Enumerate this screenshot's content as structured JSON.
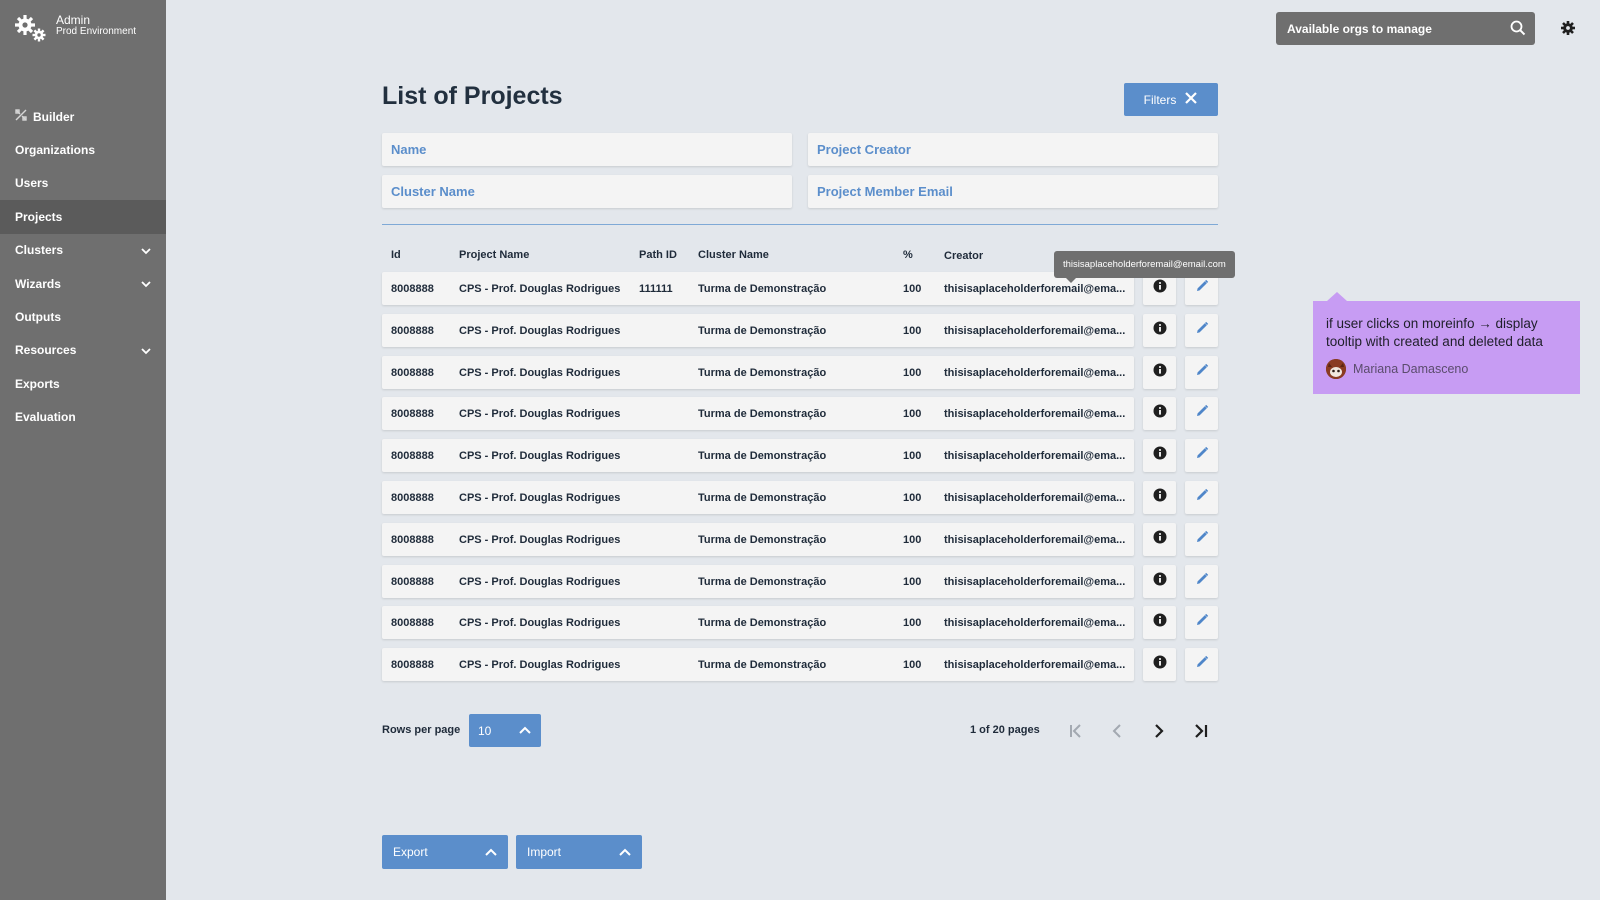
{
  "sidebar": {
    "brand": {
      "title": "Admin",
      "subtitle": "Prod Environment"
    },
    "items": [
      {
        "label": "Builder",
        "icon": "builder-icon",
        "expandable": false,
        "active": false
      },
      {
        "label": "Organizations",
        "expandable": false,
        "active": false
      },
      {
        "label": "Users",
        "expandable": false,
        "active": false
      },
      {
        "label": "Projects",
        "expandable": false,
        "active": true
      },
      {
        "label": "Clusters",
        "expandable": true,
        "active": false
      },
      {
        "label": "Wizards",
        "expandable": true,
        "active": false
      },
      {
        "label": "Outputs",
        "expandable": false,
        "active": false
      },
      {
        "label": "Resources",
        "expandable": true,
        "active": false
      },
      {
        "label": "Exports",
        "expandable": false,
        "active": false
      },
      {
        "label": "Evaluation",
        "expandable": false,
        "active": false
      }
    ]
  },
  "topbar": {
    "search_placeholder": "Available orgs to manage"
  },
  "main": {
    "title": "List of Projects",
    "filters_label": "Filters",
    "filter_fields": {
      "name": "Name",
      "creator": "Project Creator",
      "cluster": "Cluster Name",
      "member_email": "Project Member Email"
    },
    "columns": {
      "id": "Id",
      "project_name": "Project Name",
      "path_id": "Path ID",
      "cluster_name": "Cluster Name",
      "percent": "%",
      "creator": "Creator"
    },
    "rows": [
      {
        "id": "8008888",
        "project_name": "CPS - Prof. Douglas Rodrigues",
        "path_id": "111111",
        "cluster_name": "Turma de Demonstração",
        "percent": "100",
        "creator": "thisisaplaceholderforemail@ema..."
      },
      {
        "id": "8008888",
        "project_name": "CPS - Prof. Douglas Rodrigues",
        "path_id": "",
        "cluster_name": "Turma de Demonstração",
        "percent": "100",
        "creator": "thisisaplaceholderforemail@ema..."
      },
      {
        "id": "8008888",
        "project_name": "CPS - Prof. Douglas Rodrigues",
        "path_id": "",
        "cluster_name": "Turma de Demonstração",
        "percent": "100",
        "creator": "thisisaplaceholderforemail@ema..."
      },
      {
        "id": "8008888",
        "project_name": "CPS - Prof. Douglas Rodrigues",
        "path_id": "",
        "cluster_name": "Turma de Demonstração",
        "percent": "100",
        "creator": "thisisaplaceholderforemail@ema..."
      },
      {
        "id": "8008888",
        "project_name": "CPS - Prof. Douglas Rodrigues",
        "path_id": "",
        "cluster_name": "Turma de Demonstração",
        "percent": "100",
        "creator": "thisisaplaceholderforemail@ema..."
      },
      {
        "id": "8008888",
        "project_name": "CPS - Prof. Douglas Rodrigues",
        "path_id": "",
        "cluster_name": "Turma de Demonstração",
        "percent": "100",
        "creator": "thisisaplaceholderforemail@ema..."
      },
      {
        "id": "8008888",
        "project_name": "CPS - Prof. Douglas Rodrigues",
        "path_id": "",
        "cluster_name": "Turma de Demonstração",
        "percent": "100",
        "creator": "thisisaplaceholderforemail@ema..."
      },
      {
        "id": "8008888",
        "project_name": "CPS - Prof. Douglas Rodrigues",
        "path_id": "",
        "cluster_name": "Turma de Demonstração",
        "percent": "100",
        "creator": "thisisaplaceholderforemail@ema..."
      },
      {
        "id": "8008888",
        "project_name": "CPS - Prof. Douglas Rodrigues",
        "path_id": "",
        "cluster_name": "Turma de Demonstração",
        "percent": "100",
        "creator": "thisisaplaceholderforemail@ema..."
      },
      {
        "id": "8008888",
        "project_name": "CPS - Prof. Douglas Rodrigues",
        "path_id": "",
        "cluster_name": "Turma de Demonstração",
        "percent": "100",
        "creator": "thisisaplaceholderforemail@ema..."
      }
    ],
    "email_tooltip": "thisisaplaceholderforemail@email.com",
    "pagination": {
      "rows_per_page_label": "Rows per page",
      "rows_per_page_value": "10",
      "page_info": "1 of 20 pages"
    },
    "export_label": "Export",
    "import_label": "Import"
  },
  "annotation": {
    "text": "if user clicks on moreinfo → display tooltip with created and deleted data",
    "author": "Mariana Damasceno"
  },
  "colors": {
    "sidebar_bg": "#6f6f6f",
    "accent": "#5b8ecb",
    "page_bg": "#e3e7ec",
    "note_bg": "#c79cf3"
  },
  "icons": [
    "gears-icon",
    "builder-icon",
    "chevron-down-icon",
    "search-icon",
    "gear-icon",
    "close-icon",
    "info-icon",
    "pencil-icon",
    "chevron-up-icon",
    "first-page-icon",
    "prev-page-icon",
    "next-page-icon",
    "last-page-icon",
    "avatar"
  ]
}
